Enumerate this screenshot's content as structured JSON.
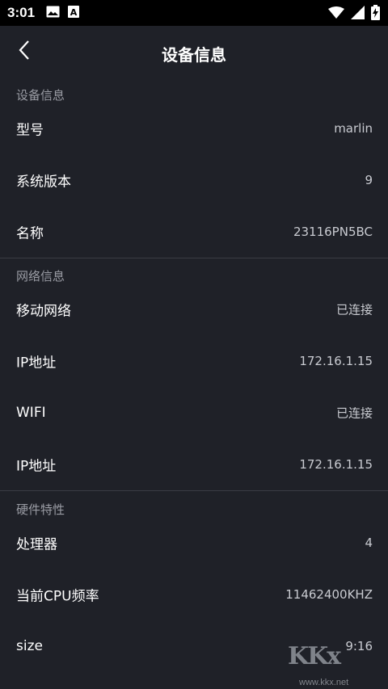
{
  "status_bar": {
    "time": "3:01",
    "icons": [
      "image-icon",
      "text-a-icon",
      "wifi-icon",
      "signal-icon",
      "battery-charging-icon"
    ]
  },
  "header": {
    "title": "设备信息",
    "back_icon": "chevron-left-icon"
  },
  "sections": {
    "device": {
      "title": "设备信息",
      "rows": [
        {
          "label": "型号",
          "value": "marlin"
        },
        {
          "label": "系统版本",
          "value": "9"
        },
        {
          "label": "名称",
          "value": "23116PN5BC"
        }
      ]
    },
    "network": {
      "title": "网络信息",
      "rows": [
        {
          "label": "移动网络",
          "value": "已连接"
        },
        {
          "label": "IP地址",
          "value": "172.16.1.15"
        },
        {
          "label": "WIFI",
          "value": "已连接"
        },
        {
          "label": "IP地址",
          "value": "172.16.1.15"
        }
      ]
    },
    "hardware": {
      "title": "硬件特性",
      "rows": [
        {
          "label": "处理器",
          "value": "4"
        },
        {
          "label": "当前CPU频率",
          "value": "11462400KHZ"
        },
        {
          "label": "size",
          "value": "9:16"
        }
      ]
    }
  },
  "watermark": {
    "letters": "KKx",
    "url": "www.kkx.net"
  },
  "colors": {
    "background": "#1f2128",
    "status_bar": "#000000",
    "section_header": "#9a9ca4",
    "divider": "#3a3c44"
  }
}
